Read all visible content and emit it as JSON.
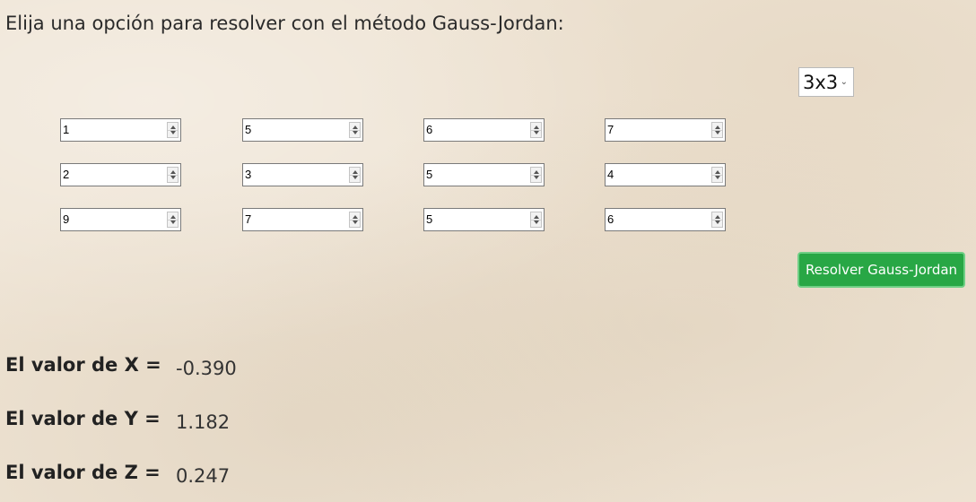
{
  "instruction": "Elija una opción para resolver con el método Gauss-Jordan:",
  "size_select": {
    "value": "3x3"
  },
  "matrix": [
    [
      "1",
      "5",
      "6",
      "7"
    ],
    [
      "2",
      "3",
      "5",
      "4"
    ],
    [
      "9",
      "7",
      "5",
      "6"
    ]
  ],
  "solve_button": "Resolver Gauss-Jordan",
  "results": [
    {
      "label": "El valor de X =",
      "value": "-0.390"
    },
    {
      "label": "El valor de Y =",
      "value": "1.182"
    },
    {
      "label": "El valor de Z =",
      "value": "0.247"
    }
  ],
  "colors": {
    "button": "#28a745",
    "background": "#eee3d3"
  }
}
